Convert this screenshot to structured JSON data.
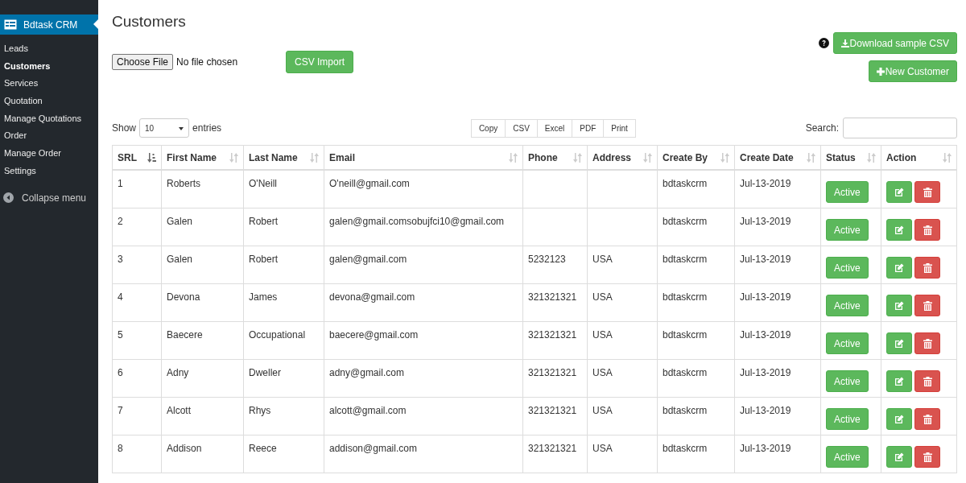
{
  "sidebar": {
    "brand": "Bdtask CRM",
    "items": [
      {
        "label": "Leads",
        "selected": false
      },
      {
        "label": "Customers",
        "selected": true
      },
      {
        "label": "Services",
        "selected": false
      },
      {
        "label": "Quotation",
        "selected": false
      },
      {
        "label": "Manage Quotations",
        "selected": false
      },
      {
        "label": "Order",
        "selected": false
      },
      {
        "label": "Manage Order",
        "selected": false
      },
      {
        "label": "Settings",
        "selected": false
      }
    ],
    "collapse": "Collapse menu"
  },
  "page_title": "Customers",
  "file_input": {
    "button": "Choose File",
    "status": "No file chosen"
  },
  "csv_import": "CSV Import",
  "download_sample": "Download sample CSV",
  "new_customer": "New Customer",
  "length": {
    "prefix": "Show",
    "value": "10",
    "suffix": "entries"
  },
  "export_buttons": [
    "Copy",
    "CSV",
    "Excel",
    "PDF",
    "Print"
  ],
  "search": {
    "label": "Search:"
  },
  "table": {
    "columns": [
      {
        "label": "SRL",
        "sorted": true
      },
      {
        "label": "First Name",
        "sorted": false
      },
      {
        "label": "Last Name",
        "sorted": false
      },
      {
        "label": "Email",
        "sorted": false
      },
      {
        "label": "Phone",
        "sorted": false
      },
      {
        "label": "Address",
        "sorted": false
      },
      {
        "label": "Create By",
        "sorted": false
      },
      {
        "label": "Create Date",
        "sorted": false
      },
      {
        "label": "Status",
        "sorted": false
      },
      {
        "label": "Action",
        "sorted": false
      }
    ],
    "rows": [
      {
        "srl": "1",
        "first": "Roberts",
        "last": "O'Neill",
        "email": "O'neill@gmail.com",
        "phone": "",
        "address": "",
        "by": "bdtaskcrm",
        "date": "Jul-13-2019",
        "status": "Active"
      },
      {
        "srl": "2",
        "first": "Galen",
        "last": "Robert",
        "email": "galen@gmail.comsobujfci10@gmail.com",
        "phone": "",
        "address": "",
        "by": "bdtaskcrm",
        "date": "Jul-13-2019",
        "status": "Active"
      },
      {
        "srl": "3",
        "first": "Galen",
        "last": "Robert",
        "email": "galen@gmail.com",
        "phone": "5232123",
        "address": "USA",
        "by": "bdtaskcrm",
        "date": "Jul-13-2019",
        "status": "Active"
      },
      {
        "srl": "4",
        "first": "Devona",
        "last": "James",
        "email": "devona@gmail.com",
        "phone": "321321321",
        "address": "USA",
        "by": "bdtaskcrm",
        "date": "Jul-13-2019",
        "status": "Active"
      },
      {
        "srl": "5",
        "first": "Baecere",
        "last": "Occupational",
        "email": "baecere@gmail.com",
        "phone": "321321321",
        "address": "USA",
        "by": "bdtaskcrm",
        "date": "Jul-13-2019",
        "status": "Active"
      },
      {
        "srl": "6",
        "first": "Adny",
        "last": "Dweller",
        "email": "adny@gmail.com",
        "phone": "321321321",
        "address": "USA",
        "by": "bdtaskcrm",
        "date": "Jul-13-2019",
        "status": "Active"
      },
      {
        "srl": "7",
        "first": "Alcott",
        "last": "Rhys",
        "email": "alcott@gmail.com",
        "phone": "321321321",
        "address": "USA",
        "by": "bdtaskcrm",
        "date": "Jul-13-2019",
        "status": "Active"
      },
      {
        "srl": "8",
        "first": "Addison",
        "last": "Reece",
        "email": "addison@gmail.com",
        "phone": "321321321",
        "address": "USA",
        "by": "bdtaskcrm",
        "date": "Jul-13-2019",
        "status": "Active"
      }
    ]
  }
}
